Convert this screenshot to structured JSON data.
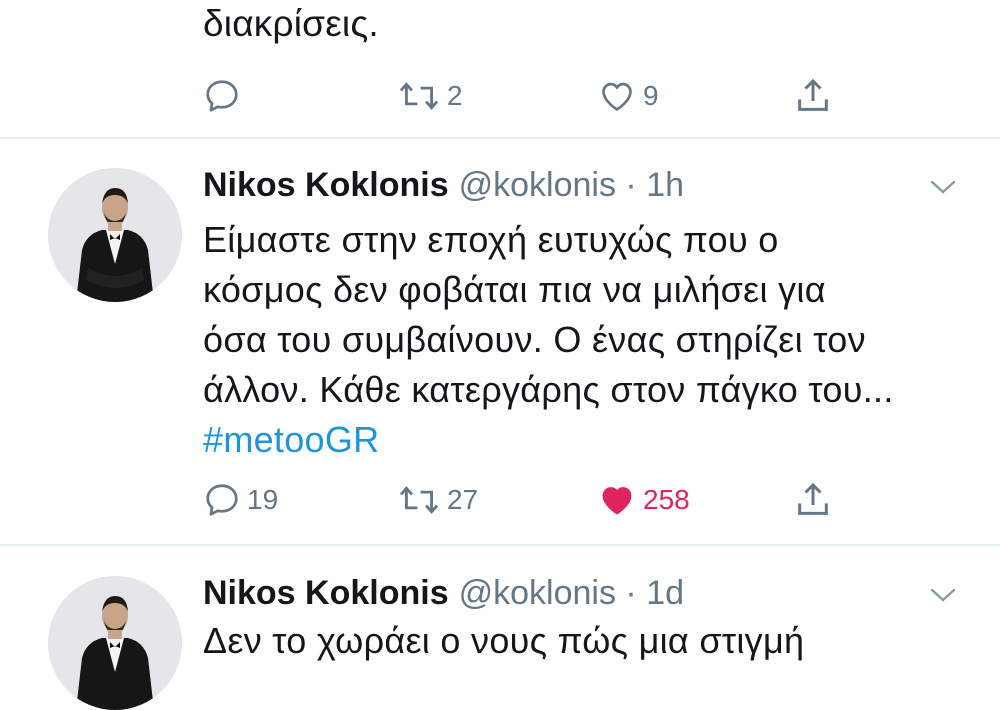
{
  "prev_tweet": {
    "text_tail": "διακρίσεις.",
    "actions": {
      "retweets": "2",
      "likes": "9"
    }
  },
  "tweet1": {
    "author_name": "Nikos Koklonis",
    "handle": "@koklonis",
    "separator": "·",
    "time": "1h",
    "lines": [
      "Είμαστε στην εποχή ευτυχώς  που ο",
      "κόσμος δεν φοβάται πια να μιλήσει για",
      "όσα του συμβαίνουν. Ο ένας στηρίζει τον",
      "άλλον. Κάθε κατεργάρης στον πάγκο του..."
    ],
    "hashtag": "#metooGR",
    "actions": {
      "replies": "19",
      "retweets": "27",
      "likes": "258"
    }
  },
  "tweet2": {
    "author_name": "Nikos Koklonis",
    "handle": "@koklonis",
    "separator": "·",
    "time": "1d",
    "first_line": "Δεν το χωράει ο νους πώς μια στιγμή"
  },
  "colors": {
    "text": "#14171a",
    "secondary": "#657786",
    "link": "#1b95e0",
    "like": "#e0245e",
    "divider": "#e6ecf0"
  },
  "icons": [
    "reply-icon",
    "retweet-icon",
    "like-icon",
    "share-icon",
    "chevron-down-icon"
  ]
}
